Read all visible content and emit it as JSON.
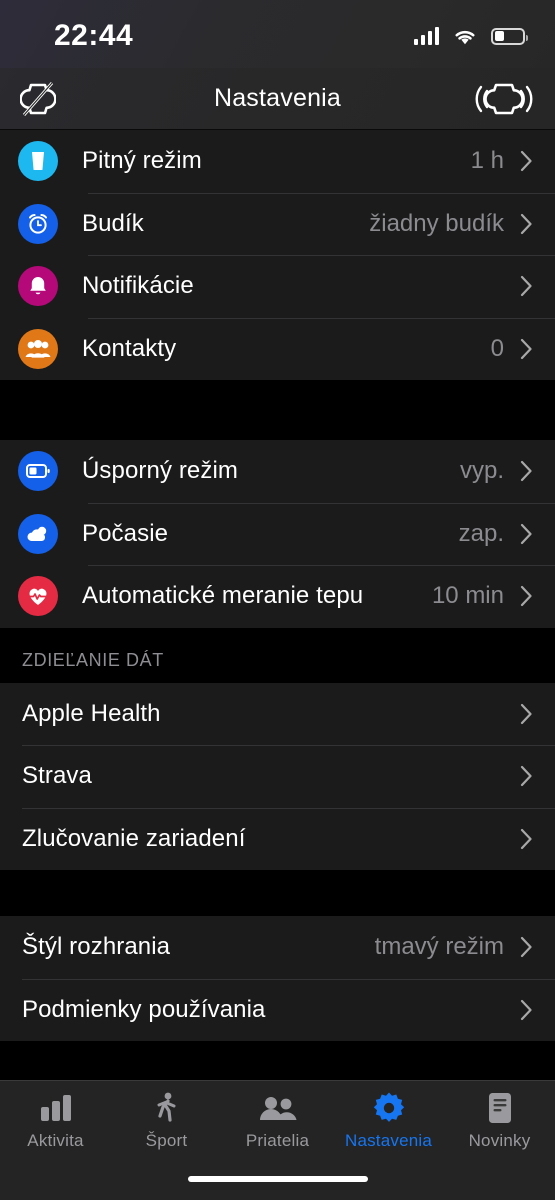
{
  "status_bar": {
    "time": "22:44",
    "signal_icon": "cellular-signal-icon",
    "wifi_icon": "wifi-icon",
    "battery_icon": "battery-low-icon"
  },
  "nav_bar": {
    "title": "Nastavenia",
    "left_icon": "watch-disconnected-icon",
    "right_icon": "watch-vibration-icon"
  },
  "sections": [
    {
      "id": "general",
      "header": "",
      "rows": [
        {
          "icon": "water-glass-icon",
          "icon_color": "#1eb8f0",
          "label": "Pitný režim",
          "value": "1 h"
        },
        {
          "icon": "alarm-clock-icon",
          "icon_color": "#1560e8",
          "label": "Budík",
          "value": "žiadny budík"
        },
        {
          "icon": "bell-icon",
          "icon_color": "#b5097a",
          "label": "Notifikácie",
          "value": ""
        },
        {
          "icon": "contacts-icon",
          "icon_color": "#e07818",
          "label": "Kontakty",
          "value": "0"
        }
      ]
    },
    {
      "id": "device",
      "header": "",
      "rows": [
        {
          "icon": "battery-icon",
          "icon_color": "#1560e8",
          "label": "Úsporný režim",
          "value": "vyp."
        },
        {
          "icon": "weather-cloud-icon",
          "icon_color": "#1560e8",
          "label": "Počasie",
          "value": "zap."
        },
        {
          "icon": "heart-pulse-icon",
          "icon_color": "#e52b44",
          "label": "Automatické meranie tepu",
          "value": "10 min"
        }
      ]
    },
    {
      "id": "data-sharing",
      "header": "ZDIEĽANIE DÁT",
      "rows": [
        {
          "icon": "",
          "icon_color": "",
          "label": "Apple Health",
          "value": ""
        },
        {
          "icon": "",
          "icon_color": "",
          "label": "Strava",
          "value": ""
        },
        {
          "icon": "",
          "icon_color": "",
          "label": "Zlučovanie zariadení",
          "value": ""
        }
      ]
    },
    {
      "id": "appearance",
      "header": "",
      "rows": [
        {
          "icon": "",
          "icon_color": "",
          "label": "Štýl rozhrania",
          "value": "tmavý režim"
        },
        {
          "icon": "",
          "icon_color": "",
          "label": "Podmienky používania",
          "value": ""
        }
      ]
    }
  ],
  "tab_bar": {
    "active": "Nastavenia",
    "active_color": "#1675f0",
    "inactive_color": "#9a9a9e",
    "tabs": [
      {
        "label": "Aktivita",
        "icon": "bar-chart-icon"
      },
      {
        "label": "Šport",
        "icon": "walking-person-icon"
      },
      {
        "label": "Priatelia",
        "icon": "people-icon"
      },
      {
        "label": "Nastavenia",
        "icon": "gear-icon"
      },
      {
        "label": "Novinky",
        "icon": "document-icon"
      }
    ]
  }
}
